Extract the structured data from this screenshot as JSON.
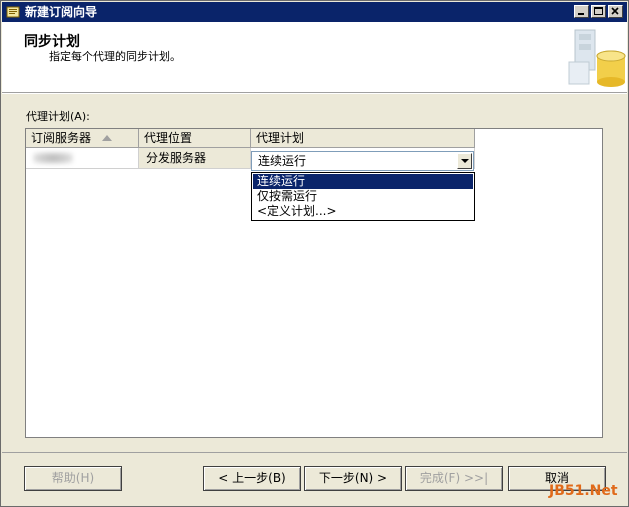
{
  "window": {
    "title": "新建订阅向导"
  },
  "header": {
    "title": "同步计划",
    "subtitle": "指定每个代理的同步计划。"
  },
  "agent_schedule": {
    "label": "代理计划(A):",
    "columns": [
      "订阅服务器",
      "代理位置",
      "代理计划"
    ],
    "rows": [
      {
        "subscriber": "",
        "location": "分发服务器",
        "schedule": "连续运行"
      }
    ],
    "dropdown_options": [
      "连续运行",
      "仅按需运行",
      "<定义计划...>"
    ],
    "selected_option": "连续运行"
  },
  "buttons": {
    "help": "帮助(H)",
    "back": "< 上一步(B)",
    "next": "下一步(N) >",
    "finish": "完成(F) >>|",
    "cancel": "取消"
  },
  "watermark": "JB51.Net",
  "colors": {
    "titlebar": "#0a246a",
    "selection": "#0a246a",
    "dialog_bg": "#ece9d8"
  }
}
